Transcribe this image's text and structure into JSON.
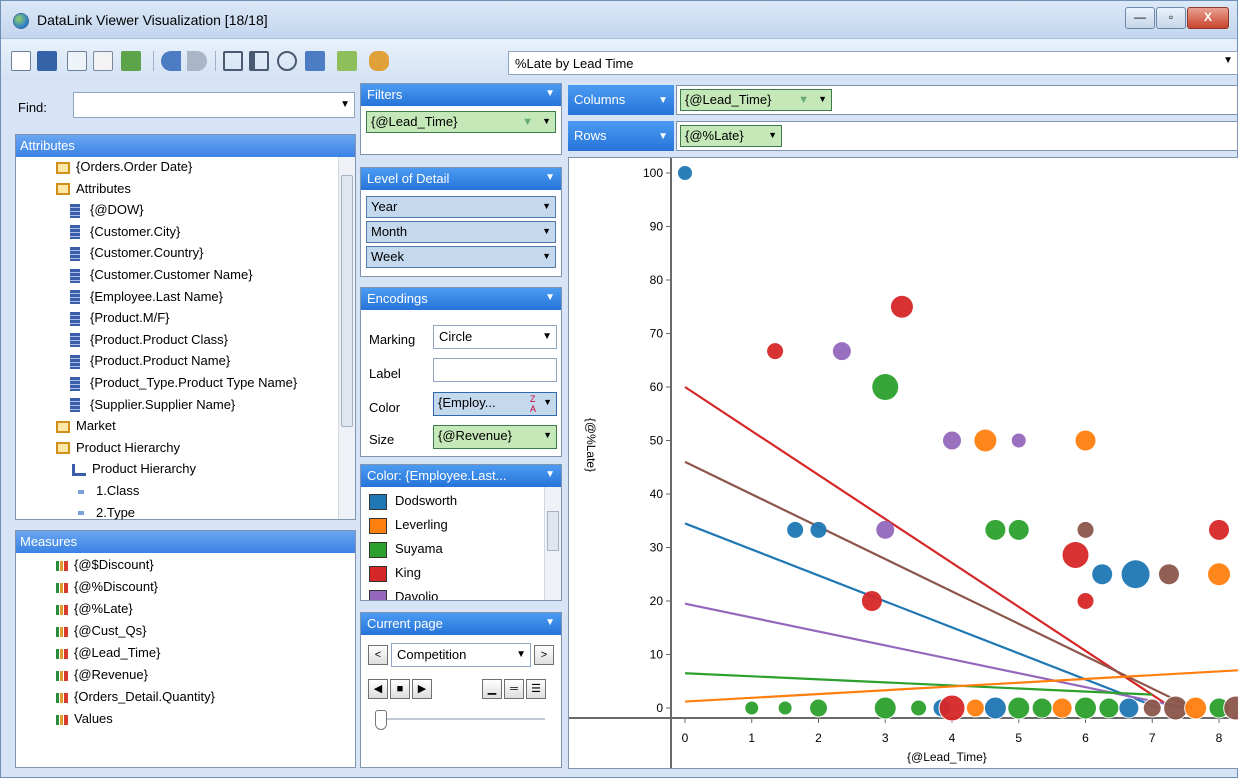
{
  "window": {
    "title": "DataLink Viewer Visualization [18/18]",
    "min": "—",
    "max": "▫",
    "close": "X"
  },
  "toolbar": {
    "viz_select": "%Late by Lead Time"
  },
  "find": {
    "label": "Find:",
    "value": ""
  },
  "attributes": {
    "header": "Attributes",
    "items": [
      "{Orders.Order Date}",
      "Attributes",
      "{@DOW}",
      "{Customer.City}",
      "{Customer.Country}",
      "{Customer.Customer Name}",
      "{Employee.Last Name}",
      "{Product.M/F}",
      "{Product.Product Class}",
      "{Product.Product Name}",
      "{Product_Type.Product Type Name}",
      "{Supplier.Supplier Name}",
      "Market",
      "Product Hierarchy",
      "Product Hierarchy",
      "1.Class",
      "2.Type"
    ]
  },
  "measures": {
    "header": "Measures",
    "items": [
      "{@$Discount}",
      "{@%Discount}",
      "{@%Late}",
      "{@Cust_Qs}",
      "{@Lead_Time}",
      "{@Revenue}",
      "{Orders_Detail.Quantity}",
      "Values"
    ]
  },
  "filters": {
    "header": "Filters",
    "pill": "{@Lead_Time}"
  },
  "lod": {
    "header": "Level of Detail",
    "items": [
      "Year",
      "Month",
      "Week"
    ]
  },
  "encodings": {
    "header": "Encodings",
    "marking_label": "Marking",
    "marking_value": "Circle",
    "label_label": "Label",
    "label_value": "",
    "color_label": "Color",
    "color_value": "{Employ...",
    "size_label": "Size",
    "size_value": "{@Revenue}"
  },
  "color_legend": {
    "header": "Color: {Employee.Last...",
    "items": [
      {
        "name": "Dodsworth",
        "color": "#1f77b4"
      },
      {
        "name": "Leverling",
        "color": "#ff7f0e"
      },
      {
        "name": "Suyama",
        "color": "#2ca02c"
      },
      {
        "name": "King",
        "color": "#d62728"
      },
      {
        "name": "Davolio",
        "color": "#9467bd"
      }
    ]
  },
  "current_page": {
    "header": "Current page",
    "value": "Competition"
  },
  "shelves": {
    "columns_label": "Columns",
    "columns_pill": "{@Lead_Time}",
    "rows_label": "Rows",
    "rows_pill": "{@%Late}"
  },
  "chart_data": {
    "type": "scatter",
    "xlabel": "{@Lead_Time}",
    "ylabel": "{@%Late}",
    "xlim": [
      -0.2,
      8.5
    ],
    "ylim": [
      -1,
      101
    ],
    "xticks": [
      "0",
      "1",
      "2",
      "3",
      "4",
      "5",
      "6",
      "7",
      "8"
    ],
    "yticks": [
      "0",
      "10",
      "20",
      "30",
      "40",
      "50",
      "60",
      "70",
      "80",
      "90",
      "100"
    ],
    "points": [
      {
        "x": 0,
        "y": 100,
        "r": 7,
        "c": "#1f77b4"
      },
      {
        "x": 1.35,
        "y": 66.7,
        "r": 8,
        "c": "#d62728"
      },
      {
        "x": 2.35,
        "y": 66.7,
        "r": 9,
        "c": "#9467bd"
      },
      {
        "x": 3.25,
        "y": 75,
        "r": 11,
        "c": "#d62728"
      },
      {
        "x": 3,
        "y": 60,
        "r": 13,
        "c": "#2ca02c"
      },
      {
        "x": 4,
        "y": 50,
        "r": 9,
        "c": "#9467bd"
      },
      {
        "x": 4.5,
        "y": 50,
        "r": 11,
        "c": "#ff7f0e"
      },
      {
        "x": 5,
        "y": 50,
        "r": 7,
        "c": "#9467bd"
      },
      {
        "x": 6,
        "y": 50,
        "r": 10,
        "c": "#ff7f0e"
      },
      {
        "x": 1.65,
        "y": 33.3,
        "r": 8,
        "c": "#1f77b4"
      },
      {
        "x": 2,
        "y": 33.3,
        "r": 8,
        "c": "#1f77b4"
      },
      {
        "x": 3,
        "y": 33.3,
        "r": 9,
        "c": "#9467bd"
      },
      {
        "x": 4.65,
        "y": 33.3,
        "r": 10,
        "c": "#2ca02c"
      },
      {
        "x": 5,
        "y": 33.3,
        "r": 10,
        "c": "#2ca02c"
      },
      {
        "x": 6,
        "y": 33.3,
        "r": 8,
        "c": "#8c564b"
      },
      {
        "x": 8,
        "y": 33.3,
        "r": 10,
        "c": "#d62728"
      },
      {
        "x": 5.85,
        "y": 28.6,
        "r": 13,
        "c": "#d62728"
      },
      {
        "x": 6.25,
        "y": 25,
        "r": 10,
        "c": "#1f77b4"
      },
      {
        "x": 6.75,
        "y": 25,
        "r": 14,
        "c": "#1f77b4"
      },
      {
        "x": 7.25,
        "y": 25,
        "r": 10,
        "c": "#8c564b"
      },
      {
        "x": 8,
        "y": 25,
        "r": 11,
        "c": "#ff7f0e"
      },
      {
        "x": 2.8,
        "y": 20,
        "r": 10,
        "c": "#d62728"
      },
      {
        "x": 6,
        "y": 20,
        "r": 8,
        "c": "#d62728"
      },
      {
        "x": 1,
        "y": 0,
        "r": 7,
        "c": "#2ca02c"
      },
      {
        "x": 1.5,
        "y": 0,
        "r": 7,
        "c": "#2ca02c"
      },
      {
        "x": 2,
        "y": 0,
        "r": 9,
        "c": "#2ca02c"
      },
      {
        "x": 3,
        "y": 0,
        "r": 11,
        "c": "#2ca02c"
      },
      {
        "x": 3.5,
        "y": 0,
        "r": 8,
        "c": "#2ca02c"
      },
      {
        "x": 3.85,
        "y": 0,
        "r": 9,
        "c": "#1f77b4"
      },
      {
        "x": 4,
        "y": 0,
        "r": 13,
        "c": "#d62728"
      },
      {
        "x": 4.35,
        "y": 0,
        "r": 9,
        "c": "#ff7f0e"
      },
      {
        "x": 4.65,
        "y": 0,
        "r": 11,
        "c": "#1f77b4"
      },
      {
        "x": 5,
        "y": 0,
        "r": 11,
        "c": "#2ca02c"
      },
      {
        "x": 5.35,
        "y": 0,
        "r": 10,
        "c": "#2ca02c"
      },
      {
        "x": 5.65,
        "y": 0,
        "r": 10,
        "c": "#ff7f0e"
      },
      {
        "x": 6,
        "y": 0,
        "r": 11,
        "c": "#2ca02c"
      },
      {
        "x": 6.35,
        "y": 0,
        "r": 10,
        "c": "#2ca02c"
      },
      {
        "x": 6.65,
        "y": 0,
        "r": 10,
        "c": "#1f77b4"
      },
      {
        "x": 7,
        "y": 0,
        "r": 9,
        "c": "#8c564b"
      },
      {
        "x": 7.35,
        "y": 0,
        "r": 12,
        "c": "#8c564b"
      },
      {
        "x": 7.65,
        "y": 0,
        "r": 11,
        "c": "#ff7f0e"
      },
      {
        "x": 8,
        "y": 0,
        "r": 10,
        "c": "#2ca02c"
      },
      {
        "x": 8.25,
        "y": 0,
        "r": 12,
        "c": "#8c564b"
      }
    ],
    "trendlines": [
      {
        "c": "#d62728",
        "x1": 0,
        "y1": 60,
        "x2": 7.3,
        "y2": 0
      },
      {
        "c": "#8c564b",
        "x1": 0,
        "y1": 46,
        "x2": 7.6,
        "y2": 0
      },
      {
        "c": "#1f77b4",
        "x1": 0,
        "y1": 34.5,
        "x2": 7.1,
        "y2": 0
      },
      {
        "c": "#9467bd",
        "x1": 0,
        "y1": 19.5,
        "x2": 7.5,
        "y2": 0
      },
      {
        "c": "#2ca02c",
        "x1": 0,
        "y1": 6.5,
        "x2": 7.0,
        "y2": 2.5
      },
      {
        "c": "#ff7f0e",
        "x1": 0,
        "y1": 1.2,
        "x2": 8.5,
        "y2": 7.2
      }
    ]
  }
}
